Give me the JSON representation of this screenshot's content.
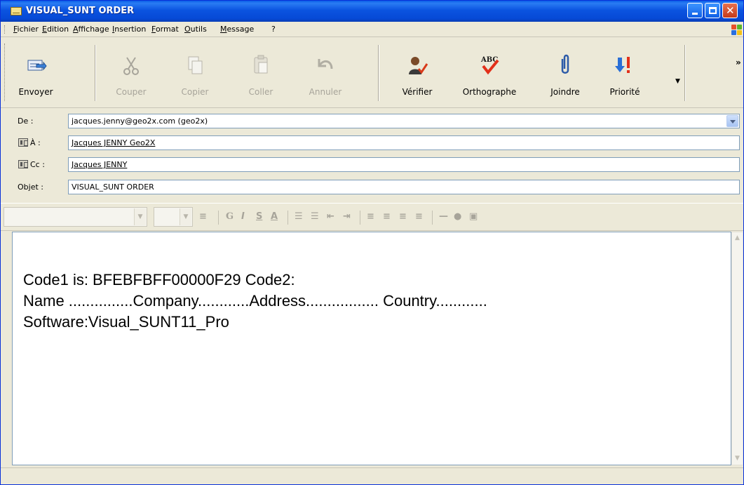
{
  "window": {
    "title": "VISUAL_SUNT ORDER"
  },
  "menu": {
    "items": [
      "Fichier",
      "Edition",
      "Affichage",
      "Insertion",
      "Format",
      "Outils",
      "Message",
      "?"
    ]
  },
  "toolbar": {
    "buttons": [
      {
        "label": "Envoyer",
        "icon": "send-icon",
        "enabled": true
      },
      {
        "label": "Couper",
        "icon": "scissors-icon",
        "enabled": false
      },
      {
        "label": "Copier",
        "icon": "copy-icon",
        "enabled": false
      },
      {
        "label": "Coller",
        "icon": "paste-icon",
        "enabled": false
      },
      {
        "label": "Annuler",
        "icon": "undo-icon",
        "enabled": false
      },
      {
        "label": "Vérifier",
        "icon": "check-names-icon",
        "enabled": true
      },
      {
        "label": "Orthographe",
        "icon": "spelling-icon",
        "enabled": true
      },
      {
        "label": "Joindre",
        "icon": "paperclip-icon",
        "enabled": true
      },
      {
        "label": "Priorité",
        "icon": "priority-icon",
        "enabled": true
      }
    ]
  },
  "header": {
    "from_label": "De :",
    "from_value": "jacques.jenny@geo2x.com   (geo2x)",
    "to_label": "À :",
    "to_value": "Jacques JENNY Geo2X",
    "cc_label": "Cc :",
    "cc_value": "Jacques JENNY",
    "subject_label": "Objet :",
    "subject_value": "VISUAL_SUNT ORDER"
  },
  "body": {
    "line1": "Code1 is:  BFEBFBFF00000F29   Code2:",
    "line2": "Name ...............Company............Address................. Country............",
    "line3": "Software:Visual_SUNT11_Pro"
  },
  "colors": {
    "titlebar": "#0b54e0",
    "accent": "#316ac5",
    "chrome": "#ece9d8"
  }
}
